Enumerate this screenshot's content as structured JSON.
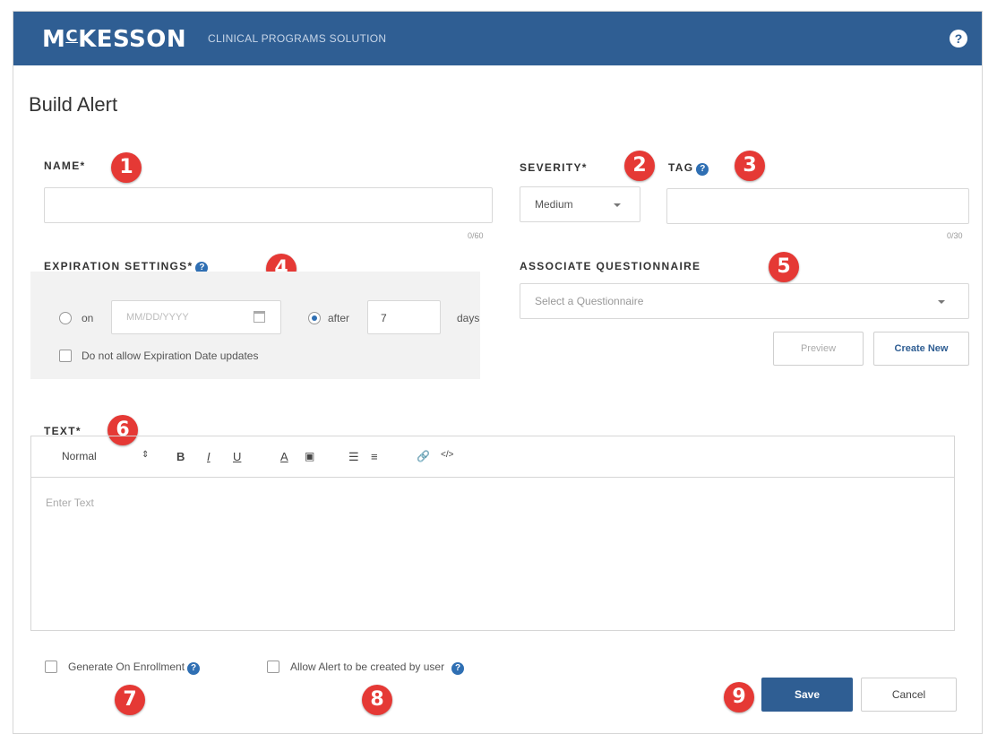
{
  "header": {
    "logo_main": "MCKESSON",
    "logo_small_c": "C",
    "subtitle": "CLINICAL PROGRAMS SOLUTION",
    "help_icon": "?"
  },
  "page": {
    "title": "Build Alert"
  },
  "name": {
    "label": "NAME*",
    "value": "",
    "counter": "0/60"
  },
  "severity": {
    "label": "SEVERITY*",
    "value": "Medium"
  },
  "tag": {
    "label": "TAG",
    "value": "",
    "counter": "0/30"
  },
  "expiration": {
    "label": "EXPIRATION SETTINGS*",
    "on_label": "on",
    "date_placeholder": "MM/DD/YYYY",
    "after_label": "after",
    "after_value": "7",
    "days_label": "days",
    "selected": "after",
    "no_update_label": "Do not allow Expiration Date updates"
  },
  "questionnaire": {
    "label": "ASSOCIATE QUESTIONNAIRE",
    "placeholder": "Select a Questionnaire",
    "preview_label": "Preview",
    "create_label": "Create New"
  },
  "text": {
    "label": "TEXT*",
    "format_value": "Normal",
    "placeholder": "Enter Text"
  },
  "toolbar": {
    "bold": "B",
    "italic": "I",
    "underline": "U",
    "font_color": "A",
    "code": "</>"
  },
  "options": {
    "generate_label": "Generate On Enrollment",
    "allow_label": "Allow Alert to be created by user"
  },
  "actions": {
    "save_label": "Save",
    "cancel_label": "Cancel"
  },
  "badges": [
    "1",
    "2",
    "3",
    "4",
    "5",
    "6",
    "7",
    "8",
    "9"
  ],
  "colors": {
    "header_bg": "#2f5e93",
    "badge": "#e53935",
    "accent": "#2f6fb3"
  }
}
